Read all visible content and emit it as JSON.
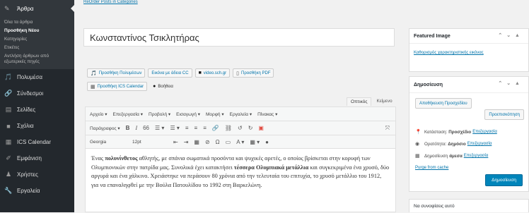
{
  "sidebar": {
    "active": {
      "icon": "pin-icon",
      "label": "Άρθρα"
    },
    "submenu": [
      {
        "label": "Όλα τα άρθρα",
        "bold": false
      },
      {
        "label": "Προσθήκη Νέου",
        "bold": true
      },
      {
        "label": "Κατηγορίες",
        "bold": false
      },
      {
        "label": "Ετικέτες",
        "bold": false
      },
      {
        "label": "Αντλήση άρθρων από",
        "bold": false
      },
      {
        "label": "εξωτερικές πηγές",
        "bold": false
      }
    ],
    "items": [
      {
        "icon": "media-icon",
        "label": "Πολυμέσα"
      },
      {
        "icon": "link-icon",
        "label": "Σύνδεσμοι"
      },
      {
        "icon": "pages-icon",
        "label": "Σελίδες"
      },
      {
        "icon": "comments-icon",
        "label": "Σχόλια"
      },
      {
        "icon": "calendar-icon",
        "label": "ICS Calendar"
      },
      {
        "icon": "appearance-icon",
        "label": "Εμφάνιση"
      },
      {
        "icon": "users-icon",
        "label": "Χρήστες"
      },
      {
        "icon": "tools-icon",
        "label": "Εργαλεία"
      }
    ]
  },
  "top_link": "ReOrder Posts in Categories",
  "post_title": "Κωνσταντίνος Τσικλητήρας",
  "media_buttons": {
    "row1": [
      "Προσθήκη Πολυμέσων",
      "Εικόνα με άδεια CC",
      "video.sch.gr",
      "Προσθήκη PDF"
    ],
    "row2": [
      "Προσθήκη ICS Calendar",
      "Βοήθεια"
    ]
  },
  "editor_tabs": {
    "visual": "Οπτικός",
    "text": "Κείμενο"
  },
  "toolbar": {
    "menus": [
      "Αρχείο ▾",
      "Επεξεργασία ▾",
      "Προβολή ▾",
      "Εισαγωγή ▾",
      "Μορφή ▾",
      "Εργαλεία ▾",
      "Πίνακας ▾"
    ],
    "paragraph": "Παράγραφος ▾",
    "font": "Georgia",
    "size": "12pt"
  },
  "content": {
    "p1_start": "Ένας ",
    "p1_bold1": "πολυνίνθετος",
    "p1_mid": " αθλητής, με σπάνια σωματικά προσόντα και ψυχικές αρετές, ο οποίος βρίσκεται στην κορυφή των Ολυμπιονικών στην πατρίδα μας. Συνολικά έχει κατακτήσει ",
    "p1_bold2": "τέσσερα Ολυμπιακά μετάλλια",
    "p1_end": " και συγκεκριμένα ένα χρυσό, δύο αργυρά και ένα χάλκινο. Χρειάστηκε να περάσουν 80 χρόνια από την τελευταία του επιτυχία, το χρυσό μετάλλιο του 1912, για να επαναληφθεί με την Βούλα Πατουλίδου το 1992 στη Βαρκελώνη."
  },
  "featured_image": {
    "title": "Featured Image",
    "link": "Καθορισμός χαρακτηριστικής εικόνας"
  },
  "publish": {
    "title": "Δημοσίευση",
    "save_draft": "Αποθήκευση Προσχεδίου",
    "preview": "Προεπισκόπηση",
    "status_label": "Κατάσταση:",
    "status_value": "Προσχέδιο",
    "visibility_label": "Ορατότητα:",
    "visibility_value": "Δημόσιο",
    "schedule_label": "Δημοσίευση",
    "schedule_value": "άμεσα",
    "edit": "Επεξεργασία",
    "purge": "Purge from cache",
    "publish_btn": "Δημοσίευση"
  },
  "next_panel_title": "Να συνοψίσεις αυτό"
}
